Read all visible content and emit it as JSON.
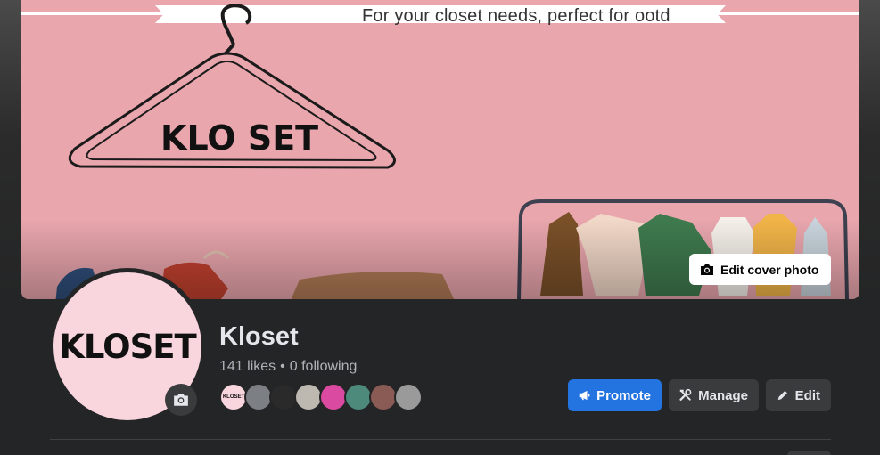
{
  "cover": {
    "tagline": "For your closet needs, perfect for ootd",
    "hanger_text": "KLO SET",
    "edit_label": "Edit cover photo",
    "background_color": "#e9a6ad"
  },
  "profile": {
    "avatar_text": "KLOSET",
    "name": "Kloset",
    "likes": "141 likes",
    "separator": "•",
    "following": "0 following"
  },
  "followers": [
    {
      "label": "KLOSET",
      "color": "#f9d5dd"
    },
    {
      "label": "",
      "color": "#7c7f84"
    },
    {
      "label": "",
      "color": "#2a2a2a"
    },
    {
      "label": "",
      "color": "#bdb8b0"
    },
    {
      "label": "",
      "color": "#d94aa0"
    },
    {
      "label": "",
      "color": "#4d8a7c"
    },
    {
      "label": "",
      "color": "#8a5a55"
    },
    {
      "label": "",
      "color": "#9a9a9a"
    }
  ],
  "actions": {
    "promote": "Promote",
    "manage": "Manage",
    "edit": "Edit"
  },
  "colors": {
    "accent": "#2374e1",
    "surface": "#242526",
    "button_secondary": "#3a3b3c"
  }
}
